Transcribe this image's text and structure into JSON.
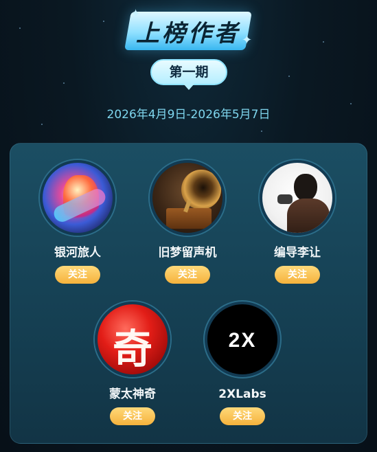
{
  "header": {
    "title": "上榜作者",
    "issue": "第一期",
    "date_range": "2026年4月9日-2026年5月7日"
  },
  "authors": [
    {
      "name": "银河旅人",
      "follow_label": "关注",
      "avatar_icon": "galaxy-warrior-avatar"
    },
    {
      "name": "旧梦留声机",
      "follow_label": "关注",
      "avatar_icon": "gramophone-avatar"
    },
    {
      "name": "编导李让",
      "follow_label": "关注",
      "avatar_icon": "portrait-avatar"
    },
    {
      "name": "蒙太神奇",
      "follow_label": "关注",
      "avatar_icon": "red-ball-avatar",
      "avatar_text": "奇"
    },
    {
      "name": "2XLabs",
      "follow_label": "关注",
      "avatar_icon": "2x-logo-avatar",
      "avatar_text": "2X"
    }
  ],
  "colors": {
    "background": "#0a1822",
    "card": "#1b4e63",
    "follow_button": "#f5b23c",
    "accent": "#8fe0ff"
  }
}
